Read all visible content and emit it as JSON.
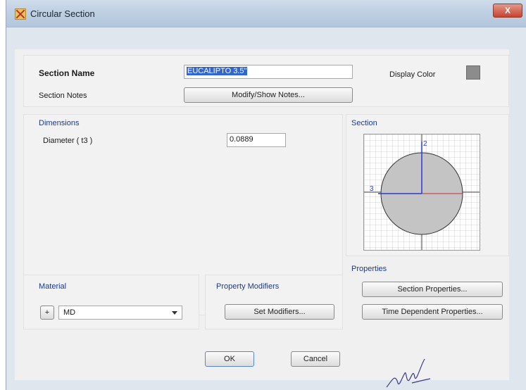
{
  "window": {
    "title": "Circular Section",
    "close_label": "X"
  },
  "section_name": {
    "label": "Section Name",
    "value": "EUCALIPTO 3.5\""
  },
  "display_color": {
    "label": "Display Color",
    "color": "#8c8c8c"
  },
  "section_notes": {
    "label": "Section Notes",
    "button": "Modify/Show Notes..."
  },
  "dimensions": {
    "header": "Dimensions",
    "diameter_label": "Diameter  ( t3 )",
    "diameter_value": "0.0889"
  },
  "section": {
    "header": "Section",
    "axis2_label": "2",
    "axis3_label": "3"
  },
  "properties": {
    "header": "Properties",
    "section_properties_button": "Section Properties...",
    "time_dependent_button": "Time Dependent Properties..."
  },
  "material": {
    "header": "Material",
    "add_button": "+",
    "value": "MD"
  },
  "property_modifiers": {
    "header": "Property Modifiers",
    "button": "Set Modifiers..."
  },
  "actions": {
    "ok": "OK",
    "cancel": "Cancel"
  }
}
